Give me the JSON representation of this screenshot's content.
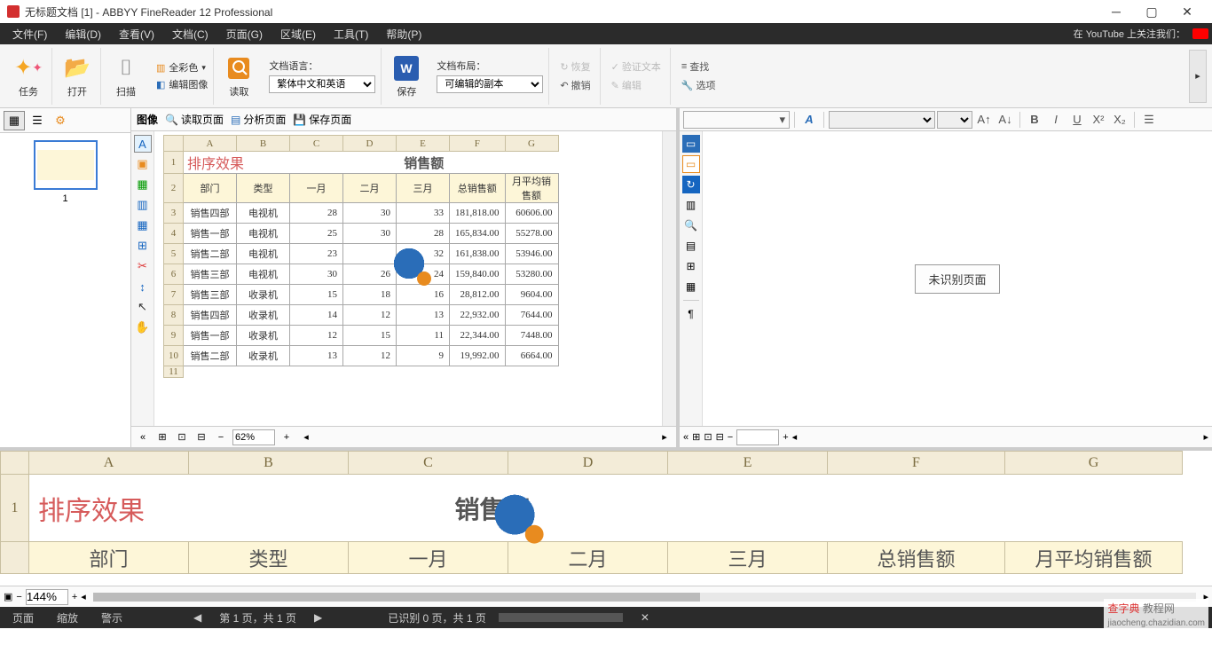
{
  "title": "无标题文档 [1] - ABBYY FineReader 12 Professional",
  "menu": [
    "文件(F)",
    "编辑(D)",
    "查看(V)",
    "文档(C)",
    "页面(G)",
    "区域(E)",
    "工具(T)",
    "帮助(P)"
  ],
  "youtube_text": "在 YouTube 上关注我们：",
  "ribbon": {
    "tasks": "任务",
    "open": "打开",
    "scan": "扫描",
    "fullcolor": "全彩色",
    "editimg": "编辑图像",
    "read": "读取",
    "doclang": "文档语言：",
    "lang_value": "繁体中文和英语",
    "save": "保存",
    "doclayout": "文档布局：",
    "layout_value": "可编辑的副本",
    "restore": "恢复",
    "undo": "撤销",
    "verify": "验证文本",
    "edit": "编辑",
    "find": "查找",
    "options": "选项"
  },
  "img_toolbar": {
    "img_label": "图像",
    "read_page": "读取页面",
    "analyze_page": "分析页面",
    "save_page": "保存页面"
  },
  "zoom1": "62%",
  "zoom2": "144%",
  "thumb_num": "1",
  "text_panel": {
    "unrecognized": "未识别页面"
  },
  "status": {
    "page": "页面",
    "zoom": "缩放",
    "warn": "警示",
    "pager": "第 1 页，共 1 页",
    "recog": "已识别 0 页，共 1 页"
  },
  "watermark": {
    "a": "查字典",
    "b": "教程网",
    "c": "jiaocheng.chazidian.com"
  },
  "chart_data": {
    "type": "table",
    "title": "销售额",
    "subtitle": "排序效果",
    "col_letters": [
      "A",
      "B",
      "C",
      "D",
      "E",
      "F",
      "G"
    ],
    "headers": [
      "部门",
      "类型",
      "一月",
      "二月",
      "三月",
      "总销售额",
      "月平均销售额"
    ],
    "rows": [
      [
        "销售四部",
        "电视机",
        "28",
        "30",
        "33",
        "181,818.00",
        "60606.00"
      ],
      [
        "销售一部",
        "电视机",
        "25",
        "30",
        "28",
        "165,834.00",
        "55278.00"
      ],
      [
        "销售二部",
        "电视机",
        "23",
        "",
        "32",
        "161,838.00",
        "53946.00"
      ],
      [
        "销售三部",
        "电视机",
        "30",
        "26",
        "24",
        "159,840.00",
        "53280.00"
      ],
      [
        "销售三部",
        "收录机",
        "15",
        "18",
        "16",
        "28,812.00",
        "9604.00"
      ],
      [
        "销售四部",
        "收录机",
        "14",
        "12",
        "13",
        "22,932.00",
        "7644.00"
      ],
      [
        "销售一部",
        "收录机",
        "12",
        "15",
        "11",
        "22,344.00",
        "7448.00"
      ],
      [
        "销售二部",
        "收录机",
        "13",
        "12",
        "9",
        "19,992.00",
        "6664.00"
      ]
    ]
  }
}
